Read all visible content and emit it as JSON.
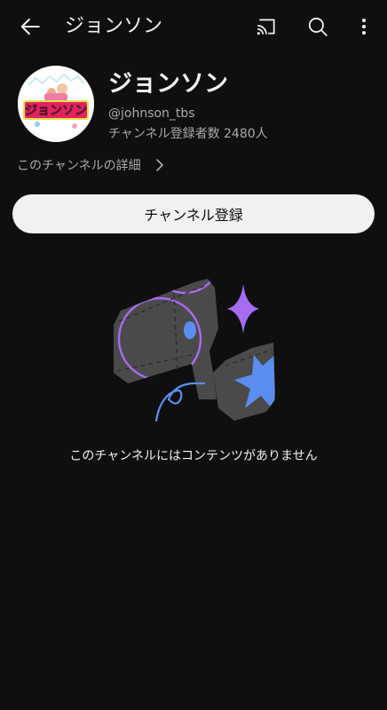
{
  "header": {
    "title": "ジョンソン",
    "icons": {
      "back": "arrow-back-icon",
      "cast": "cast-icon",
      "search": "search-icon",
      "more": "more-vert-icon"
    }
  },
  "channel": {
    "avatar_logo_text": "ジョンソン",
    "name": "ジョンソン",
    "handle": "@johnson_tbs",
    "subscribers": "チャンネル登録者数 2480人",
    "details_link": "このチャンネルの詳細"
  },
  "subscribe": {
    "label": "チャンネル登録"
  },
  "empty_state": {
    "message": "このチャンネルにはコンテンツがありません",
    "illustration": "empty-channel-illustration"
  },
  "colors": {
    "background": "#0f0f0f",
    "text_primary": "#f1f1f1",
    "text_secondary": "#aaaaaa",
    "button_bg": "#f1f1f1",
    "accent_purple": "#a66cf0",
    "accent_blue": "#5b8def"
  }
}
